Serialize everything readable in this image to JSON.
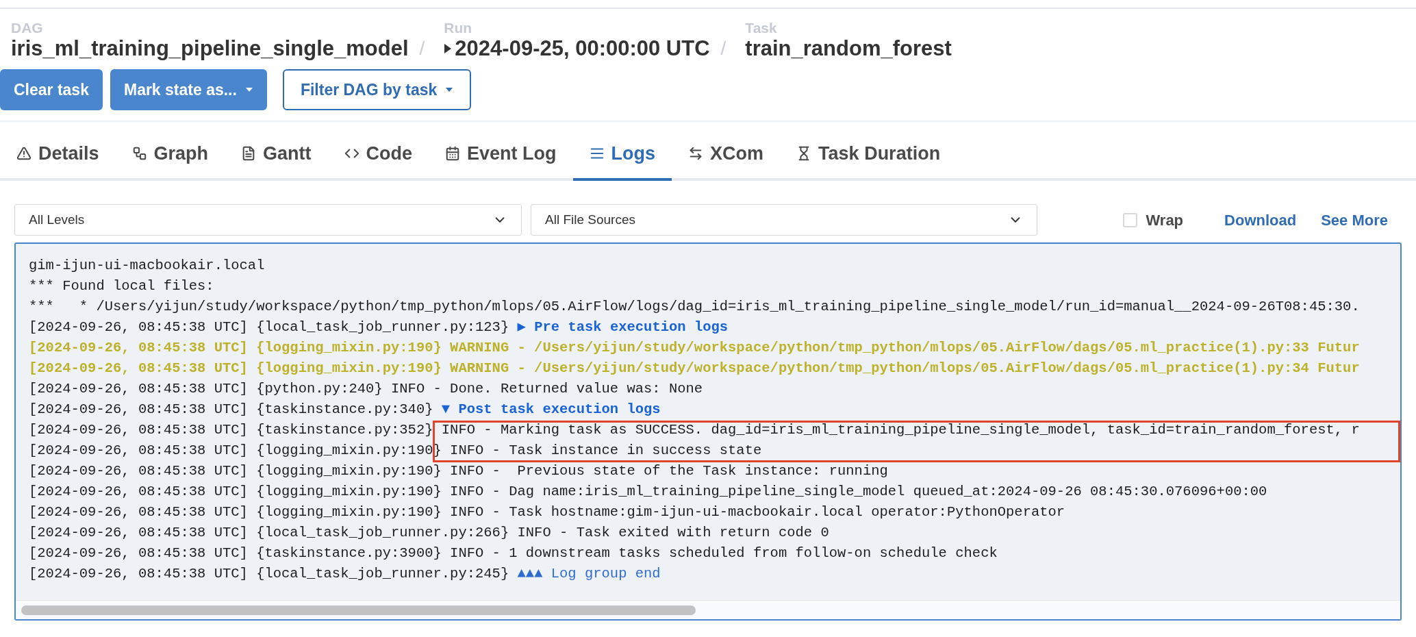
{
  "breadcrumb": [
    {
      "label": "DAG",
      "value": "iris_ml_training_pipeline_single_model",
      "kind": "plain",
      "separator": "/"
    },
    {
      "label": "Run",
      "value": "2024-09-25, 00:00:00 UTC",
      "kind": "run",
      "separator": "/"
    },
    {
      "label": "Task",
      "value": "train_random_forest",
      "kind": "plain"
    }
  ],
  "actions": [
    {
      "label": "Clear task",
      "kind": "filled",
      "caret": false
    },
    {
      "label": "Mark state as...",
      "kind": "filled",
      "caret": true
    },
    {
      "label": "Filter DAG by task",
      "kind": "outline",
      "caret": true
    }
  ],
  "tabs": [
    {
      "label": "Details",
      "selected": false
    },
    {
      "label": "Graph",
      "selected": false
    },
    {
      "label": "Gantt",
      "selected": false
    },
    {
      "label": "Code",
      "selected": false
    },
    {
      "label": "Event Log",
      "selected": false
    },
    {
      "label": "Logs",
      "selected": true
    },
    {
      "label": "XCom",
      "selected": false
    },
    {
      "label": "Task Duration",
      "selected": false
    }
  ],
  "filters": {
    "level": "All Levels",
    "source": "All File Sources",
    "wrap": {
      "label": "Wrap",
      "checked": false
    },
    "links": [
      "Download",
      "See More"
    ]
  },
  "log_lines": [
    {
      "kind": "plain",
      "text": "gim-ijun-ui-macbookair.local",
      "highlighted": false
    },
    {
      "kind": "plain",
      "text": "*** Found local files:",
      "highlighted": false
    },
    {
      "kind": "plain",
      "text": "***   * /Users/yijun/study/workspace/python/tmp_python/mlops/05.AirFlow/logs/dag_id=iris_ml_training_pipeline_single_model/run_id=manual__2024-09-26T08:45:30.",
      "highlighted": false
    },
    {
      "kind": "group_start",
      "timestamp": "[2024-09-26, 08:45:38 UTC]",
      "source": "{local_task_job_runner.py:123}",
      "text": "▶ Pre task execution logs",
      "highlighted": false
    },
    {
      "kind": "warning",
      "timestamp": "[2024-09-26, 08:45:38 UTC]",
      "source": "{logging_mixin.py:190}",
      "text": "WARNING - /Users/yijun/study/workspace/python/tmp_python/mlops/05.AirFlow/dags/05.ml_practice(1).py:33 Futur",
      "highlighted": false
    },
    {
      "kind": "warning",
      "timestamp": "[2024-09-26, 08:45:38 UTC]",
      "source": "{logging_mixin.py:190}",
      "text": "WARNING - /Users/yijun/study/workspace/python/tmp_python/mlops/05.AirFlow/dags/05.ml_practice(1).py:34 Futur",
      "highlighted": false
    },
    {
      "kind": "info",
      "timestamp": "[2024-09-26, 08:45:38 UTC]",
      "source": "{python.py:240}",
      "text": "INFO - Done. Returned value was: None",
      "highlighted": false
    },
    {
      "kind": "group_start",
      "timestamp": "[2024-09-26, 08:45:38 UTC]",
      "source": "{taskinstance.py:340}",
      "text": "▼ Post task execution logs",
      "highlighted": false
    },
    {
      "kind": "info",
      "timestamp": "[2024-09-26, 08:45:38 UTC]",
      "source": "{taskinstance.py:352}",
      "text": "INFO - Marking task as SUCCESS. dag_id=iris_ml_training_pipeline_single_model, task_id=train_random_forest, r",
      "highlighted": true
    },
    {
      "kind": "info",
      "timestamp": "[2024-09-26, 08:45:38 UTC]",
      "source": "{logging_mixin.py:190}",
      "text": "INFO - Task instance in success state",
      "highlighted": true
    },
    {
      "kind": "info",
      "timestamp": "[2024-09-26, 08:45:38 UTC]",
      "source": "{logging_mixin.py:190}",
      "text": "INFO -  Previous state of the Task instance: running",
      "highlighted": false
    },
    {
      "kind": "info",
      "timestamp": "[2024-09-26, 08:45:38 UTC]",
      "source": "{logging_mixin.py:190}",
      "text": "INFO - Dag name:iris_ml_training_pipeline_single_model queued_at:2024-09-26 08:45:30.076096+00:00",
      "highlighted": false
    },
    {
      "kind": "info",
      "timestamp": "[2024-09-26, 08:45:38 UTC]",
      "source": "{logging_mixin.py:190}",
      "text": "INFO - Task hostname:gim-ijun-ui-macbookair.local operator:PythonOperator",
      "highlighted": false
    },
    {
      "kind": "info",
      "timestamp": "[2024-09-26, 08:45:38 UTC]",
      "source": "{local_task_job_runner.py:266}",
      "text": "INFO - Task exited with return code 0",
      "highlighted": false
    },
    {
      "kind": "info",
      "timestamp": "[2024-09-26, 08:45:38 UTC]",
      "source": "{taskinstance.py:3900}",
      "text": "INFO - 1 downstream tasks scheduled from follow-on schedule check",
      "highlighted": false
    },
    {
      "kind": "group_end",
      "timestamp": "[2024-09-26, 08:45:38 UTC]",
      "source": "{local_task_job_runner.py:245}",
      "text": "▲▲▲ Log group end",
      "highlighted": false
    }
  ]
}
